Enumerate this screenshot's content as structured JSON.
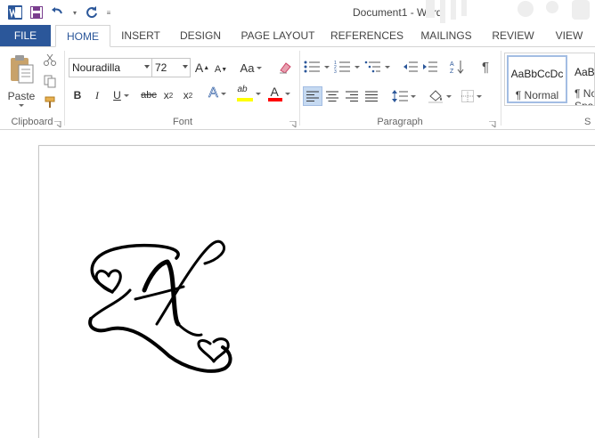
{
  "titlebar": {
    "app_icon": "word-icon",
    "title": "Document1 - Word"
  },
  "quick_access": {
    "save_icon": "save-icon",
    "undo_icon": "undo-icon",
    "redo_icon": "redo-icon",
    "customize_icon": "customize-qat-icon"
  },
  "tabs": [
    {
      "label": "FILE"
    },
    {
      "label": "HOME"
    },
    {
      "label": "INSERT"
    },
    {
      "label": "DESIGN"
    },
    {
      "label": "PAGE LAYOUT"
    },
    {
      "label": "REFERENCES"
    },
    {
      "label": "MAILINGS"
    },
    {
      "label": "REVIEW"
    },
    {
      "label": "VIEW"
    }
  ],
  "clipboard": {
    "label": "Clipboard",
    "paste_label": "Paste"
  },
  "font": {
    "label": "Font",
    "font_name": "Nouradilla",
    "font_size": "72",
    "grow_label": "A",
    "shrink_label": "A",
    "case_label": "Aa",
    "bold": "B",
    "italic": "I",
    "underline": "U",
    "strike": "abc",
    "subscript": "x",
    "superscript": "x",
    "sub_marker": "2",
    "sup_marker": "2",
    "effects_label": "A",
    "highlight_label": "ab",
    "font_color_label": "A"
  },
  "paragraph": {
    "label": "Paragraph"
  },
  "styles": {
    "items": [
      {
        "preview": "AaBbCcDc",
        "name": "¶ Normal"
      },
      {
        "preview": "AaBbCcDc",
        "name": "¶ No Spac..."
      }
    ],
    "label": "S"
  },
  "document": {
    "content_glyph": "A",
    "content_font": "Nouradilla"
  },
  "colors": {
    "file_tab": "#2b579a",
    "highlight": "#ffff00",
    "font_color": "#ff0000",
    "active_align": "#c5d9f1"
  }
}
